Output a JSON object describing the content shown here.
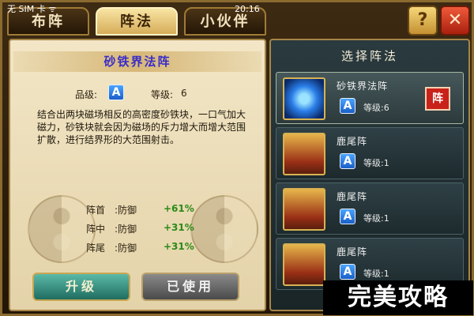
{
  "status_bar": {
    "carrier": "无 SIM 卡 ᯤ",
    "time": "20:16"
  },
  "tabs": [
    {
      "label": "布阵",
      "active": false
    },
    {
      "label": "阵法",
      "active": true
    },
    {
      "label": "小伙伴",
      "active": false
    }
  ],
  "corner": {
    "help_label": "?",
    "close_label": "✕"
  },
  "detail": {
    "title": "砂铁界法阵",
    "grade_label": "品级:",
    "grade_value": "A",
    "level_label": "等级:",
    "level_value": "6",
    "description": "结合出两块磁场相反的高密度砂铁块，一口气加大磁力，砂铁块就会因为磁场的斥力增大而增大范围扩散，进行结界形的大范围射击。",
    "bonuses": [
      {
        "position": "阵首",
        "attr": ":防御",
        "value": "+61%"
      },
      {
        "position": "阵中",
        "attr": ":防御",
        "value": "+31%"
      },
      {
        "position": "阵尾",
        "attr": ":防御",
        "value": "+31%"
      }
    ],
    "upgrade_label": "升级",
    "used_label": "已使用"
  },
  "selector": {
    "header": "选择阵法",
    "items": [
      {
        "name": "砂铁界法阵",
        "grade": "A",
        "level_label": "等级:",
        "level": "6",
        "seal": "阵",
        "thumb": "magnet"
      },
      {
        "name": "鹿尾阵",
        "grade": "A",
        "level_label": "等级:",
        "level": "1",
        "thumb": "people"
      },
      {
        "name": "鹿尾阵",
        "grade": "A",
        "level_label": "等级:",
        "level": "1",
        "thumb": "people"
      },
      {
        "name": "鹿尾阵",
        "grade": "A",
        "level_label": "等级:",
        "level": "1",
        "thumb": "people"
      }
    ]
  },
  "watermark": "完美攻略"
}
